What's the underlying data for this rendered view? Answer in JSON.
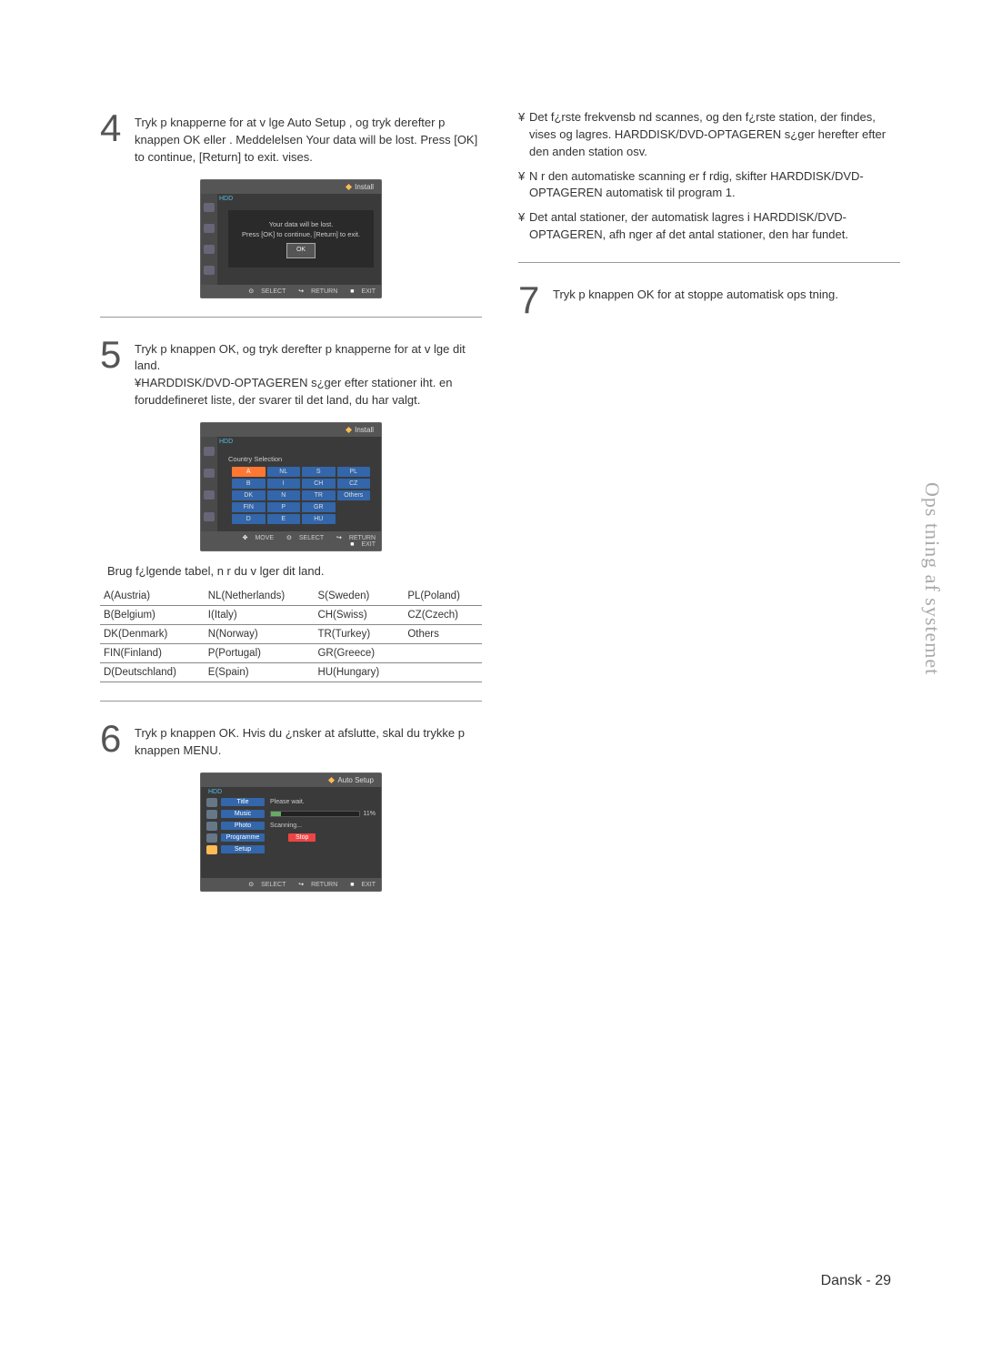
{
  "steps": {
    "s4": {
      "num": "4",
      "text": "Tryk p  knapperne        for at v lge  Auto Setup , og tryk derefter p  knappen  OK  eller    . Meddelelsen  Your data will be lost. Press [OK] to continue, [Return] to exit.  vises."
    },
    "s5": {
      "num": "5",
      "text": "Tryk p  knappen  OK, og tryk derefter p  knapperne             for at v lge dit land.\n¥HARDDISK/DVD-OPTAGEREN s¿ger efter stationer iht. en foruddefineret liste, der svarer til det land, du har valgt."
    },
    "s6": {
      "num": "6",
      "text": "Tryk p  knappen  OK. Hvis du ¿nsker at afslutte, skal du trykke p  knappen  MENU."
    },
    "s7": {
      "num": "7",
      "text": "Tryk p  knappen  OK  for at stoppe automatisk ops tning."
    }
  },
  "panel1": {
    "crumb": "Install",
    "hdd": "HDD",
    "line1": "Your data will be lost.",
    "line2": "Press [OK] to continue, [Return] to exit.",
    "ok": "OK",
    "fSelect": "SELECT",
    "fReturn": "RETURN",
    "fExit": "EXIT"
  },
  "panel2": {
    "crumb": "Install",
    "hdd": "HDD",
    "title": "Country Selection",
    "cells": [
      "A",
      "NL",
      "S",
      "PL",
      "B",
      "I",
      "CH",
      "CZ",
      "DK",
      "N",
      "TR",
      "Others",
      "FIN",
      "P",
      "GR",
      "",
      "D",
      "E",
      "HU",
      ""
    ],
    "fMove": "MOVE",
    "fSelect": "SELECT",
    "fReturn": "RETURN",
    "fExit": "EXIT"
  },
  "countryIntro": "Brug f¿lgende tabel, n r du v lger dit land.",
  "countryTable": [
    [
      "A(Austria)",
      "NL(Netherlands)",
      "S(Sweden)",
      "PL(Poland)"
    ],
    [
      "B(Belgium)",
      "I(Italy)",
      "CH(Swiss)",
      "CZ(Czech)"
    ],
    [
      "DK(Denmark)",
      "N(Norway)",
      "TR(Turkey)",
      "Others"
    ],
    [
      "FIN(Finland)",
      "P(Portugal)",
      "GR(Greece)",
      ""
    ],
    [
      "D(Deutschland)",
      "E(Spain)",
      "HU(Hungary)",
      ""
    ]
  ],
  "panel3": {
    "crumb": "Auto Setup",
    "hdd": "HDD",
    "menu": [
      "Title",
      "Music",
      "Photo",
      "Programme",
      "Setup"
    ],
    "wait": "Please wait.",
    "pct": "11%",
    "scan": "Scanning...",
    "stop": "Stop",
    "fSelect": "SELECT",
    "fReturn": "RETURN",
    "fExit": "EXIT"
  },
  "bullets": [
    "Det f¿rste frekvensb nd scannes, og den f¿rste station, der findes, vises og lagres. HARDDISK/DVD-OPTAGEREN s¿ger herefter efter den anden station osv.",
    "N r den automatiske scanning er f rdig, skifter HARDDISK/DVD-OPTAGEREN automatisk til program 1.",
    "Det antal stationer, der automatisk lagres i HARDDISK/DVD-OPTAGEREN, afh nger af det antal stationer, den har fundet."
  ],
  "sidebar": "Ops tning af systemet",
  "pageNum": "Dansk - 29"
}
